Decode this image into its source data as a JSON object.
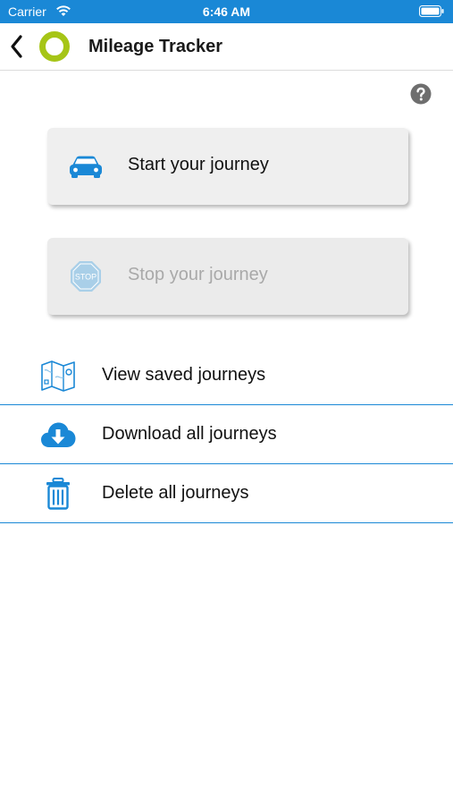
{
  "status_bar": {
    "carrier": "Carrier",
    "time": "6:46 AM"
  },
  "nav": {
    "title": "Mileage Tracker",
    "back_icon": "chevron-left-icon",
    "logo_icon": "ring-logo-icon"
  },
  "help_icon": "question-circle-icon",
  "actions": {
    "start": {
      "label": "Start your journey",
      "icon": "car-icon"
    },
    "stop": {
      "label": "Stop your journey",
      "icon": "stop-sign-icon",
      "stop_sign_text": "STOP",
      "disabled": true
    }
  },
  "menu": {
    "items": [
      {
        "label": "View saved journeys",
        "icon": "map-icon"
      },
      {
        "label": "Download all journeys",
        "icon": "cloud-download-icon"
      },
      {
        "label": "Delete all journeys",
        "icon": "trash-icon"
      }
    ]
  },
  "colors": {
    "accent": "#1a88d6",
    "logo": "#a6c517",
    "stop_icon": "#a9cfe8"
  }
}
